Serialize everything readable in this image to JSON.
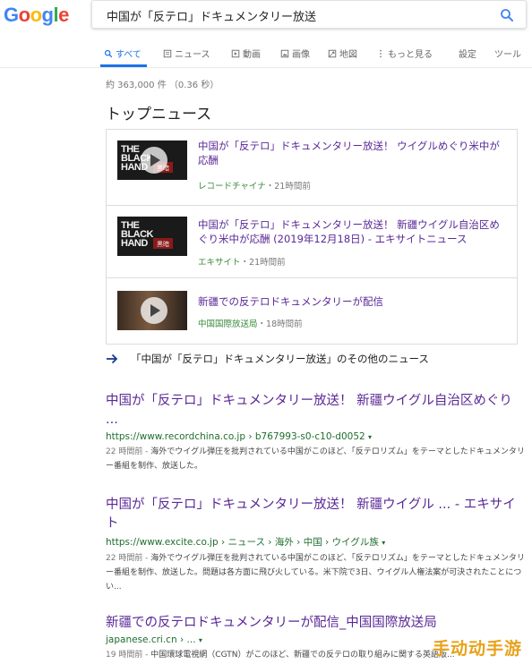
{
  "logo": {
    "letters": [
      "G",
      "o",
      "o",
      "g",
      "l",
      "e"
    ],
    "colors": [
      "#4285f4",
      "#ea4335",
      "#fbbc05",
      "#4285f4",
      "#34a853",
      "#ea4335"
    ]
  },
  "search": {
    "query": "中国が「反テロ」ドキュメンタリー放送",
    "icon": "search-icon"
  },
  "tabs": [
    {
      "label": "すべて",
      "icon": "search-icon",
      "active": true
    },
    {
      "label": "ニュース",
      "icon": "news-icon"
    },
    {
      "label": "動画",
      "icon": "video-icon"
    },
    {
      "label": "画像",
      "icon": "image-icon"
    },
    {
      "label": "地図",
      "icon": "map-icon"
    },
    {
      "label": "もっと見る",
      "icon": "more-vert-icon"
    },
    {
      "label": "設定"
    },
    {
      "label": "ツール"
    }
  ],
  "stats": "約 363,000 件 （0.36 秒）",
  "top_news": {
    "title": "トップニュース",
    "items": [
      {
        "headline": "中国が「反テロ」ドキュメンタリー放送！ ウイグルめぐり米中が応酬",
        "source": "レコードチャイナ",
        "time": "21時間前",
        "thumb_text": "THE BLACK HAND",
        "thumb_label": "黑暗"
      },
      {
        "headline": "中国が「反テロ」ドキュメンタリー放送！ 新疆ウイグル自治区めぐり米中が応酬 (2019年12月18日) - エキサイトニュース",
        "source": "エキサイト",
        "time": "21時間前",
        "thumb_text": "THE BLACK HAND",
        "thumb_label": "黑暗"
      },
      {
        "headline": "新疆での反テロドキュメンタリーが配信",
        "source": "中国国際放送局",
        "time": "18時間前"
      }
    ],
    "more_link": "「中国が「反テロ」ドキュメンタリー放送」のその他のニュース",
    "separator": "・"
  },
  "results": [
    {
      "title": "中国が「反テロ」ドキュメンタリー放送！ 新疆ウイグル自治区めぐり ...",
      "url": "https://www.recordchina.co.jp › b767993-s0-c10-d0052",
      "age": "22 時間前 - ",
      "snippet": "海外でウイグル弾圧を批判されている中国がこのほど、「反テロリズム」をテーマとしたドキュメンタリー番組を制作、放送した。"
    },
    {
      "title": "中国が「反テロ」ドキュメンタリー放送！ 新疆ウイグル ... - エキサイト",
      "url": "https://www.excite.co.jp › ニュース › 海外 › 中国 › ウイグル族",
      "age": "22 時間前 - ",
      "snippet": "海外でウイグル弾圧を批判されている中国がこのほど、「反テロリズム」をテーマとしたドキュメンタリー番組を制作、放送した。問題は各方面に飛び火している。米下院で3日、ウイグル人権法案が可決されたことについ..."
    },
    {
      "title": "新疆での反テロドキュメンタリーが配信_中国国際放送局",
      "url": "japanese.cri.cn › ...",
      "age": "19 時間前 - ",
      "snippet": "中国環球電視網（CGTN）がこのほど、新疆での反テロの取り組みに関する英語版..."
    }
  ],
  "dropdown_glyph": "▾",
  "watermark": "手动动手游"
}
